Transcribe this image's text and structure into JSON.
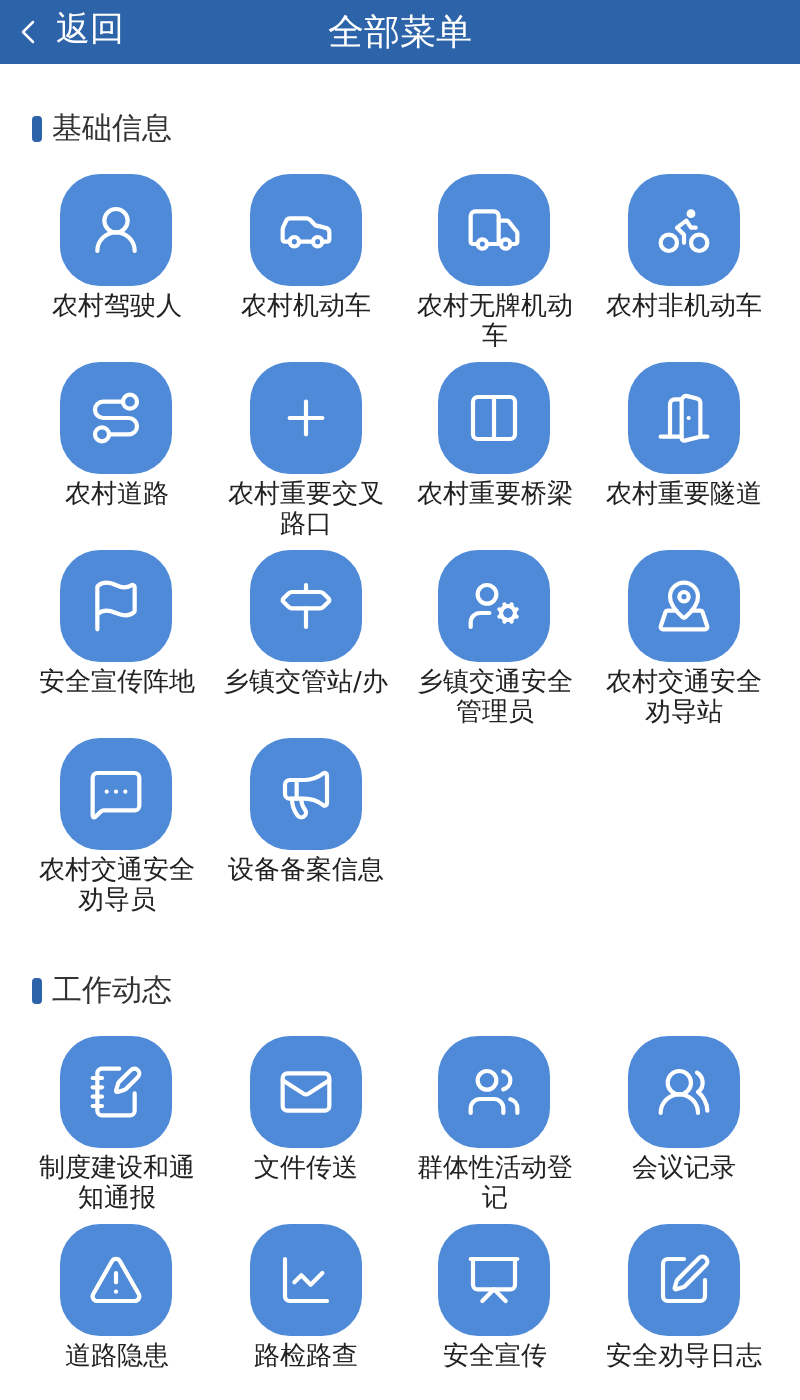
{
  "header": {
    "back": "返回",
    "title": "全部菜单"
  },
  "sections": [
    {
      "title": "基础信息",
      "items": [
        {
          "label": "农村驾驶人"
        },
        {
          "label": "农村机动车"
        },
        {
          "label": "农村无牌机动车"
        },
        {
          "label": "农村非机动车"
        },
        {
          "label": "农村道路"
        },
        {
          "label": "农村重要交叉路口"
        },
        {
          "label": "农村重要桥梁"
        },
        {
          "label": "农村重要隧道"
        },
        {
          "label": "安全宣传阵地"
        },
        {
          "label": "乡镇交管站/办"
        },
        {
          "label": "乡镇交通安全管理员"
        },
        {
          "label": "农村交通安全劝导站"
        },
        {
          "label": "农村交通安全劝导员"
        },
        {
          "label": "设备备案信息"
        }
      ]
    },
    {
      "title": "工作动态",
      "items": [
        {
          "label": "制度建设和通知通报"
        },
        {
          "label": "文件传送"
        },
        {
          "label": "群体性活动登记"
        },
        {
          "label": "会议记录"
        },
        {
          "label": "道路隐患"
        },
        {
          "label": "路检路查"
        },
        {
          "label": "安全宣传"
        },
        {
          "label": "安全劝导日志"
        }
      ]
    }
  ]
}
